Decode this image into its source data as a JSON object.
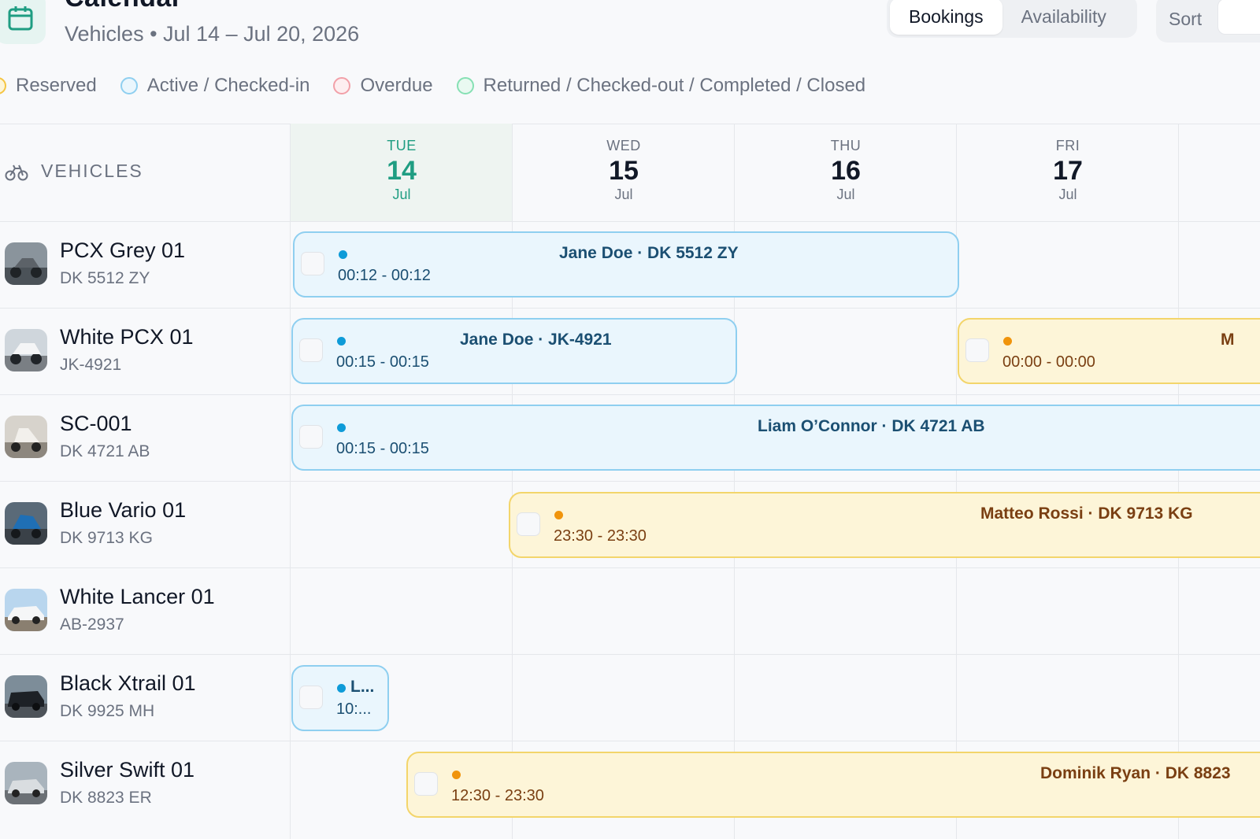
{
  "header": {
    "title": "Calendar",
    "subtitle": "Vehicles • Jul 14 – Jul 20, 2026",
    "view_tabs": [
      "Bookings",
      "Availability"
    ],
    "sort_label": "Sort"
  },
  "legend": [
    {
      "label": "Reserved",
      "color": "#f5c542"
    },
    {
      "label": "Active / Checked-in",
      "color": "#8fcff0"
    },
    {
      "label": "Overdue",
      "color": "#f2a0a8"
    },
    {
      "label": "Returned / Checked-out / Completed / Closed",
      "color": "#86e0b4"
    }
  ],
  "grid": {
    "vehicles_heading": "VEHICLES",
    "days": [
      {
        "dow": "TUE",
        "num": "14",
        "mon": "Jul",
        "today": true
      },
      {
        "dow": "WED",
        "num": "15",
        "mon": "Jul"
      },
      {
        "dow": "THU",
        "num": "16",
        "mon": "Jul"
      },
      {
        "dow": "FRI",
        "num": "17",
        "mon": "Jul"
      }
    ]
  },
  "vehicles": [
    {
      "name": "PCX Grey 01",
      "plate": "DK 5512 ZY"
    },
    {
      "name": "White PCX 01",
      "plate": "JK-4921"
    },
    {
      "name": "SC-001",
      "plate": "DK 4721 AB"
    },
    {
      "name": "Blue Vario 01",
      "plate": "DK 9713 KG"
    },
    {
      "name": "White Lancer 01",
      "plate": "AB-2937"
    },
    {
      "name": "Black Xtrail 01",
      "plate": "DK 9925 MH"
    },
    {
      "name": "Silver Swift 01",
      "plate": "DK 8823 ER"
    }
  ],
  "bookings": [
    {
      "title": "Jane Doe · DK 5512 ZY",
      "time": "00:12 - 00:12",
      "status": "active"
    },
    {
      "title": "Jane Doe · JK-4921",
      "time": "00:15 - 00:15",
      "status": "active"
    },
    {
      "title": "M",
      "time": "00:00 - 00:00",
      "status": "reserved"
    },
    {
      "title": "Liam O’Connor · DK 4721 AB",
      "time": "00:15 - 00:15",
      "status": "active"
    },
    {
      "title": "Matteo Rossi · DK 9713 KG",
      "time": "23:30 - 23:30",
      "status": "reserved"
    },
    {
      "title": "L...",
      "time": "10:...",
      "status": "active"
    },
    {
      "title": "Dominik Ryan · DK 8823",
      "time": "12:30 - 23:30",
      "status": "reserved"
    }
  ]
}
